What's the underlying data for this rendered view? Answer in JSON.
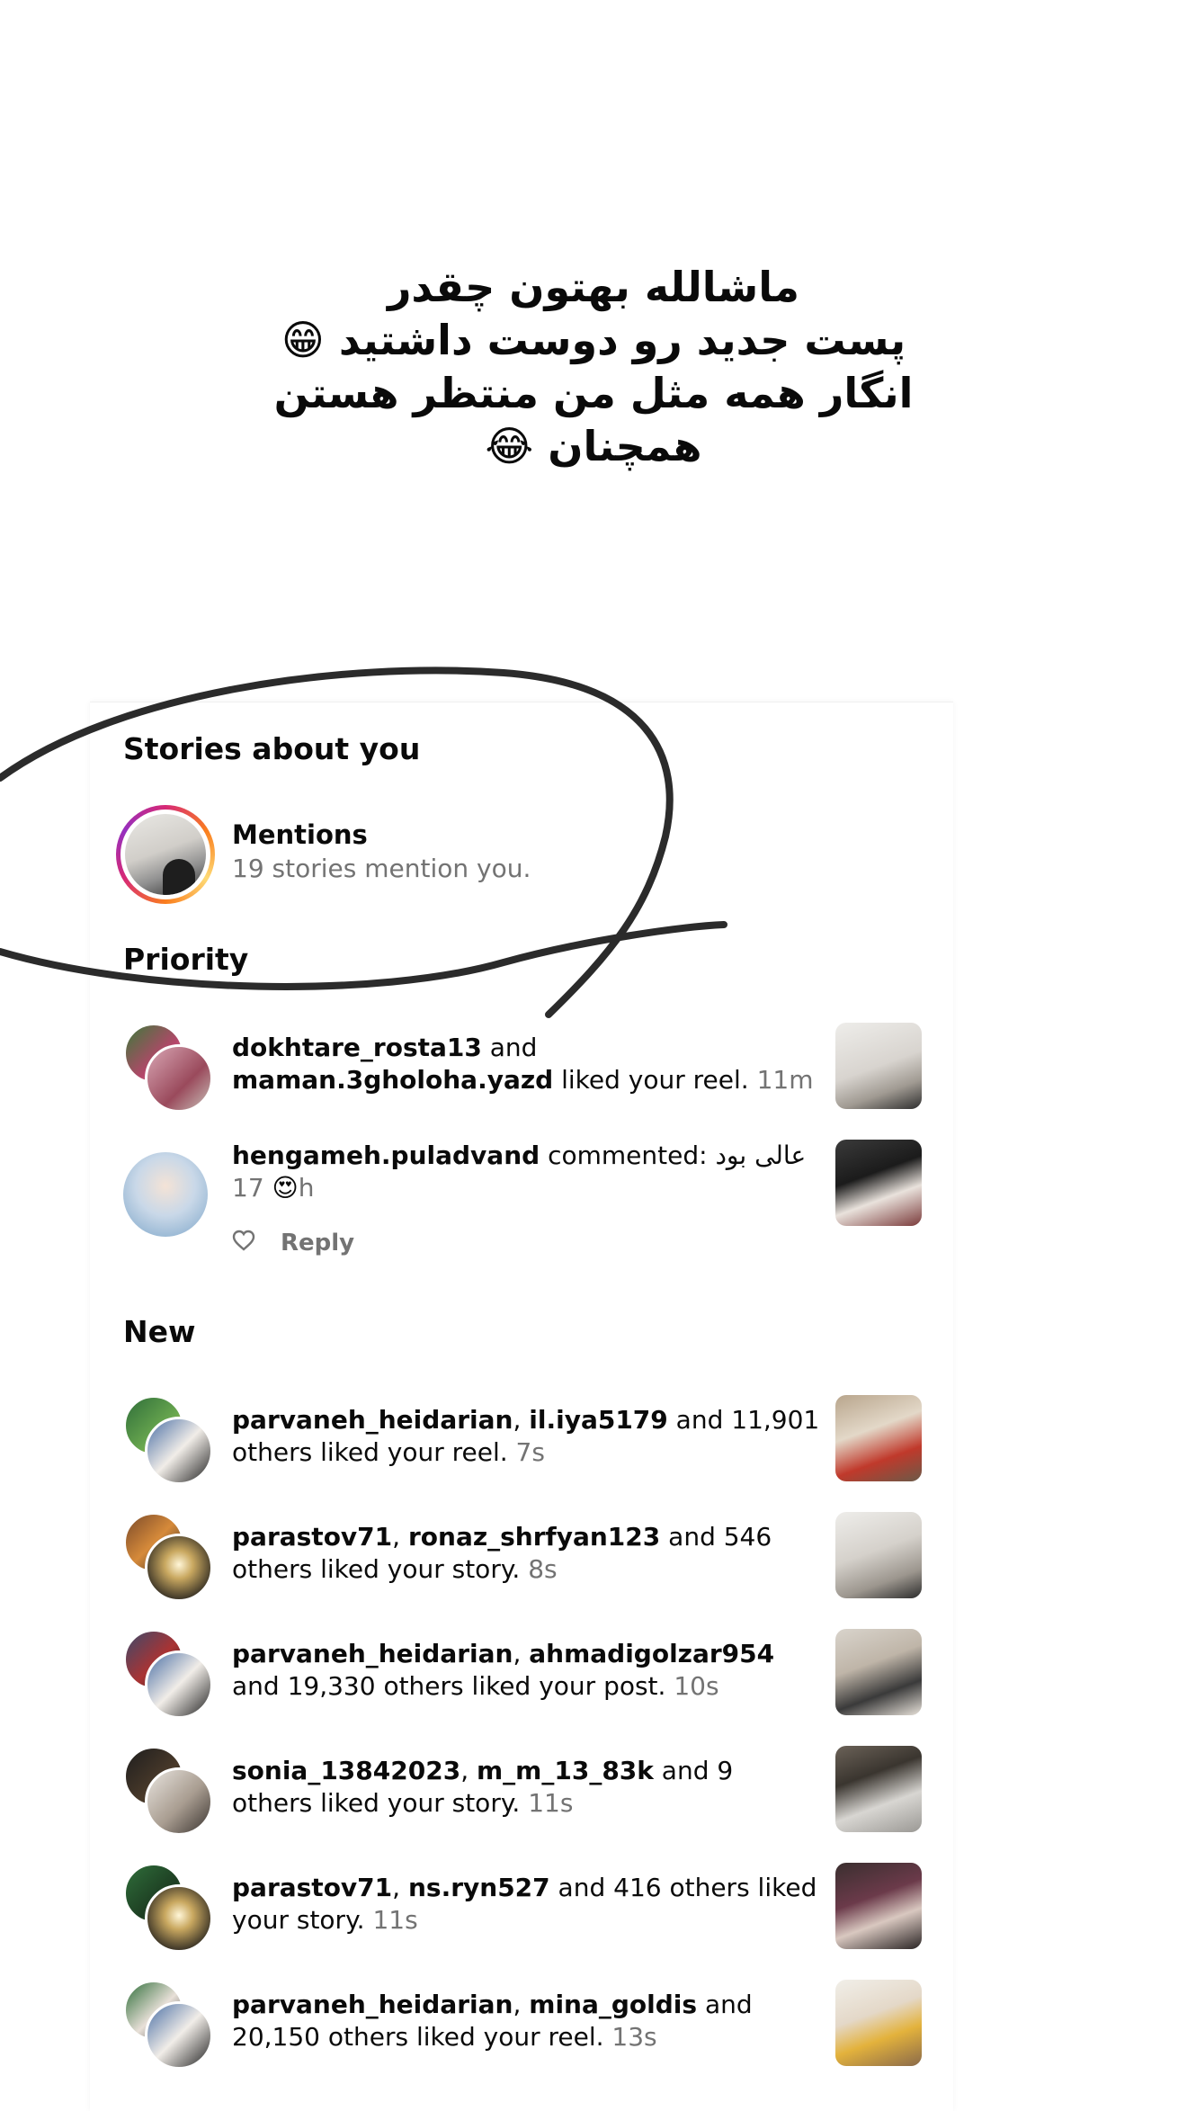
{
  "caption": {
    "lines": [
      "ماشالله بهتون چقدر",
      "پست جدید رو دوست داشتید 😁",
      "انگار همه مثل من منتظر هستن",
      "همچنان 😂"
    ]
  },
  "stories_section": {
    "title": "Stories about you",
    "mentions_title": "Mentions",
    "mentions_sub": "19 stories mention you."
  },
  "priority_section": {
    "title": "Priority",
    "items": [
      {
        "user1": "dokhtare_rosta13",
        "joiner": " and ",
        "user2": "maman.3gholoha.yazd",
        "action": " liked your reel. ",
        "time": "11m"
      },
      {
        "user1": "hengameh.puladvand",
        "action": " commented: عالی بود 😍 ",
        "time": "17h",
        "reply_label": "Reply"
      }
    ]
  },
  "new_section": {
    "title": "New",
    "items": [
      {
        "user1": "parvaneh_heidarian",
        "sep": ", ",
        "user2": "il.iya5179",
        "action": " and 11,901 others liked your reel. ",
        "time": "7s"
      },
      {
        "user1": "parastov71",
        "sep": ", ",
        "user2": "ronaz_shrfyan123",
        "action": " and 546 others liked your story. ",
        "time": "8s"
      },
      {
        "user1": "parvaneh_heidarian",
        "sep": ", ",
        "user2": "ahmadigolzar954",
        "action": " and 19,330 others liked your post. ",
        "time": "10s"
      },
      {
        "user1": "sonia_13842023",
        "sep": ", ",
        "user2": "m_m_13_83k",
        "action": " and 9 others liked your story. ",
        "time": "11s"
      },
      {
        "user1": "parastov71",
        "sep": ", ",
        "user2": "ns.ryn527",
        "action": " and 416 others liked your story. ",
        "time": "11s"
      },
      {
        "user1": "parvaneh_heidarian",
        "sep": ", ",
        "user2": "mina_goldis",
        "action": " and 20,150 others liked your reel. ",
        "time": "13s"
      }
    ]
  },
  "colors": {
    "text": "#0a0a0a",
    "secondary": "#737373",
    "scribble": "#2b2b2b"
  }
}
